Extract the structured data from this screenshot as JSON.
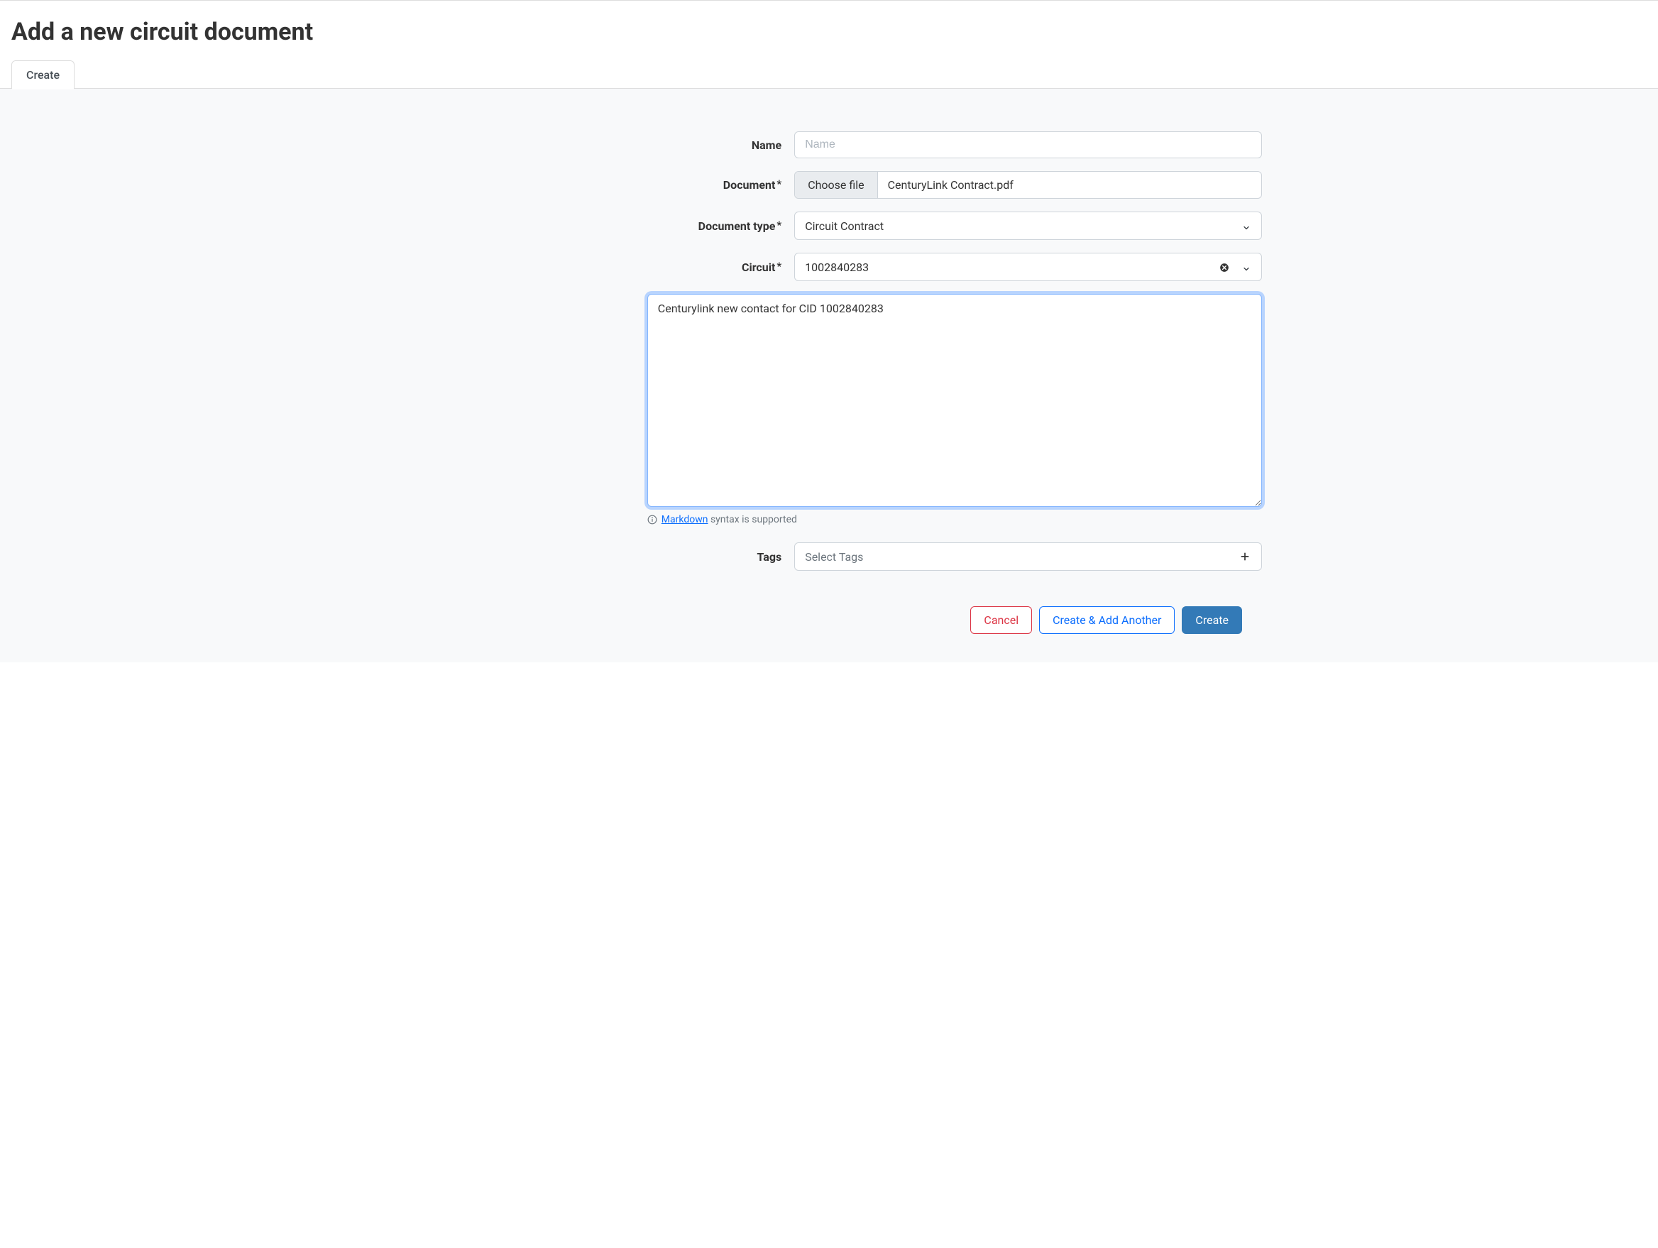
{
  "page": {
    "title": "Add a new circuit document"
  },
  "tabs": {
    "create_label": "Create"
  },
  "form": {
    "name": {
      "label": "Name",
      "placeholder": "Name",
      "value": ""
    },
    "document": {
      "label": "Document",
      "required_marker": "*",
      "button_label": "Choose file",
      "filename": "CenturyLink Contract.pdf"
    },
    "document_type": {
      "label": "Document type",
      "required_marker": "*",
      "value": "Circuit Contract"
    },
    "circuit": {
      "label": "Circuit",
      "required_marker": "*",
      "value": "1002840283"
    },
    "description": {
      "value": "Centurylink new contact for CID 1002840283"
    },
    "markdown_help": {
      "link_text": "Markdown",
      "suffix": " syntax is supported"
    },
    "tags": {
      "label": "Tags",
      "placeholder": "Select Tags"
    }
  },
  "buttons": {
    "cancel": "Cancel",
    "create_add_another": "Create & Add Another",
    "create": "Create"
  }
}
